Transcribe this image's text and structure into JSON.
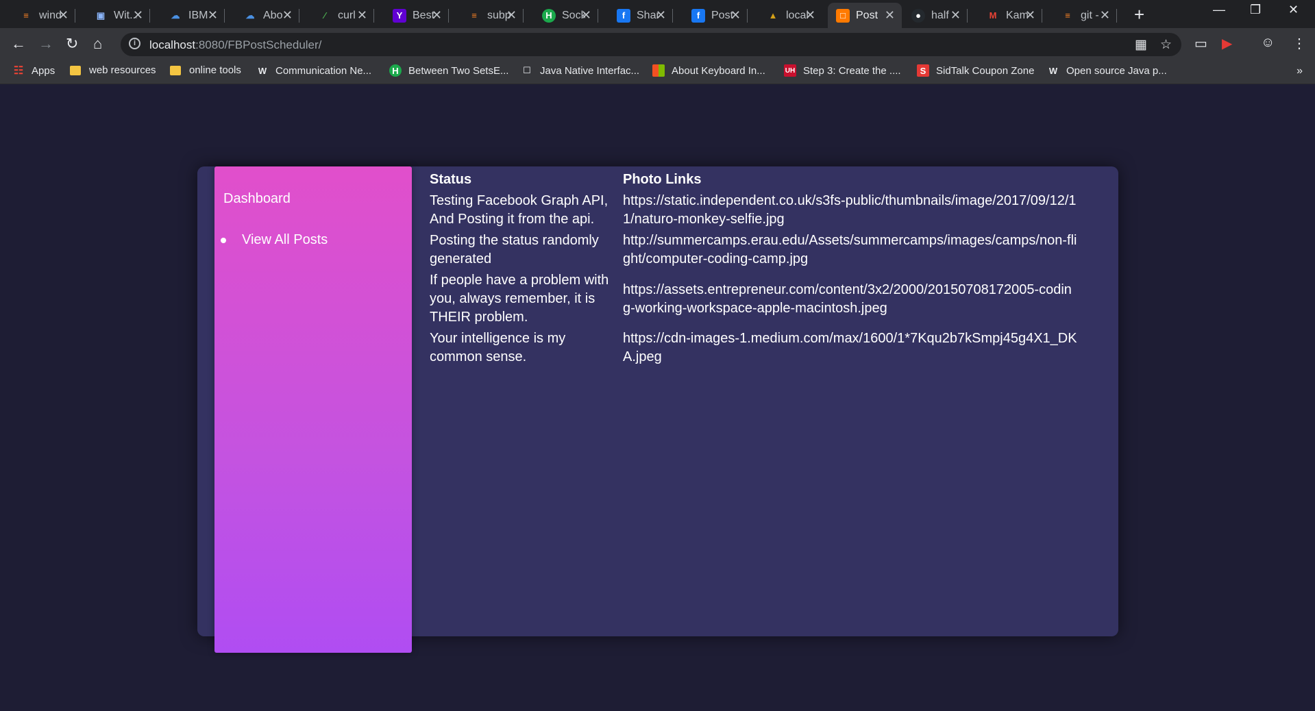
{
  "tabs": [
    {
      "title": "wind",
      "icon": "stackoverflow-icon",
      "color": "#f48024"
    },
    {
      "title": "Wit...",
      "icon": "robot-icon",
      "color": "#8ab4f8"
    },
    {
      "title": "IBM",
      "icon": "cloud-icon",
      "color": "#4a90e2"
    },
    {
      "title": "Abo",
      "icon": "cloud-icon",
      "color": "#4a90e2"
    },
    {
      "title": "curl",
      "icon": "slash-icon",
      "color": "#4caf50"
    },
    {
      "title": "Best",
      "icon": "yahoo-icon",
      "color": "#6001d2"
    },
    {
      "title": "subp",
      "icon": "stackoverflow-icon",
      "color": "#f48024"
    },
    {
      "title": "Sock",
      "icon": "hackernoon-icon",
      "color": "#1ba94c"
    },
    {
      "title": "Shar",
      "icon": "facebook-icon",
      "color": "#1877f2"
    },
    {
      "title": "Post",
      "icon": "facebook-icon",
      "color": "#1877f2"
    },
    {
      "title": "local",
      "icon": "tomcat-icon",
      "color": "#d4a017"
    },
    {
      "title": "Post",
      "icon": "postscheduler-icon",
      "color": "#ff7a00",
      "active": true
    },
    {
      "title": "half",
      "icon": "github-icon",
      "color": "#24292e"
    },
    {
      "title": "Kam",
      "icon": "gmail-icon",
      "color": "#ea4335"
    },
    {
      "title": "git -",
      "icon": "stackoverflow-icon",
      "color": "#f48024"
    }
  ],
  "address_bar": {
    "host": "localhost",
    "rest": ":8080/FBPostScheduler/"
  },
  "bookmarks": [
    {
      "label": "Apps",
      "icon": "apps-grid-icon"
    },
    {
      "label": "web resources",
      "icon": "folder-icon"
    },
    {
      "label": "online tools",
      "icon": "folder-icon"
    },
    {
      "label": "Communication Ne...",
      "icon": "ws-icon"
    },
    {
      "label": "Between Two SetsE...",
      "icon": "hackernoon-icon"
    },
    {
      "label": "Java Native Interfac...",
      "icon": "page-icon"
    },
    {
      "label": "About Keyboard In...",
      "icon": "microsoft-icon"
    },
    {
      "label": "Step 3: Create the ....",
      "icon": "uh-icon"
    },
    {
      "label": "SidTalk Coupon Zone",
      "icon": "sidtalk-icon"
    },
    {
      "label": "Open source Java p...",
      "icon": "w-icon"
    }
  ],
  "sidebar": {
    "title": "Dashboard",
    "items": [
      {
        "label": "View All Posts"
      }
    ]
  },
  "table": {
    "headers": [
      "Status",
      "Photo Links"
    ],
    "rows": [
      [
        "Testing Facebook Graph API, And Posting it from the api.",
        "https://static.independent.co.uk/s3fs-public/thumbnails/image/2017/09/12/11/naturo-monkey-selfie.jpg"
      ],
      [
        "Posting the status randomly generated",
        "http://summercamps.erau.edu/Assets/summercamps/images/camps/non-flight/computer-coding-camp.jpg"
      ],
      [
        "If people have a problem with you, always remember, it is THEIR problem.",
        "https://assets.entrepreneur.com/content/3x2/2000/20150708172005-coding-working-workspace-apple-macintosh.jpeg"
      ],
      [
        "Your intelligence is my common sense.",
        "https://cdn-images-1.medium.com/max/1600/1*7Kqu2b7kSmpj45g4X1_DKA.jpeg"
      ]
    ]
  },
  "colors": {
    "page_bg": "#1e1d34",
    "card_bg": "#343261",
    "sidebar_top": "#e14fcb",
    "sidebar_bottom": "#b04df2"
  }
}
